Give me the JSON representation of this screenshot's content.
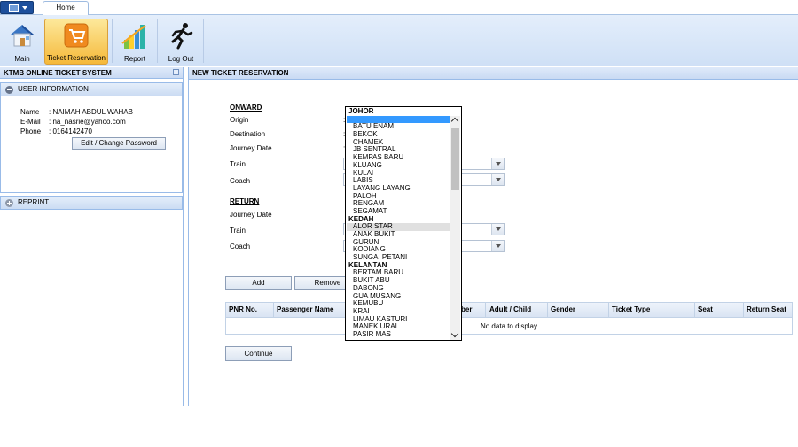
{
  "topbar": {
    "home_tab": "Home"
  },
  "ribbon": {
    "main": "Main",
    "ticket_reservation": "Ticket Reservation",
    "report": "Report",
    "logout": "Log Out"
  },
  "left": {
    "title": "KTMB ONLINE TICKET SYSTEM",
    "user_info": "USER INFORMATION",
    "name_label": "Name",
    "name_value": ": NAIMAH ABDUL WAHAB",
    "email_label": "E-Mail",
    "email_value": ": na_nasrie@yahoo.com",
    "phone_label": "Phone",
    "phone_value": ": 0164142470",
    "edit_button": "Edit / Change Password",
    "reprint": "REPRINT"
  },
  "main": {
    "title": "NEW TICKET RESERVATION",
    "onward": "ONWARD",
    "origin": "Origin",
    "destination": "Destination",
    "journey_date": "Journey Date",
    "train": "Train",
    "coach": "Coach",
    "return": "RETURN",
    "return_journey_date": "Journey Date",
    "return_train": "Train",
    "return_coach": "Coach",
    "add_button": "Add",
    "remove_button": "Remove",
    "continue_button": "Continue",
    "grid_headers": [
      "PNR No.",
      "Passenger Name",
      "ber",
      "Adult / Child",
      "Gender",
      "Ticket Type",
      "Seat",
      "Return Seat"
    ],
    "no_data": "No data to display"
  },
  "dropdown": {
    "items": [
      {
        "label": "JOHOR",
        "type": "group"
      },
      {
        "label": "",
        "type": "selected"
      },
      {
        "label": "BATU ENAM",
        "type": "item"
      },
      {
        "label": "BEKOK",
        "type": "item"
      },
      {
        "label": "CHAMEK",
        "type": "item"
      },
      {
        "label": "JB SENTRAL",
        "type": "item"
      },
      {
        "label": "KEMPAS BARU",
        "type": "item"
      },
      {
        "label": "KLUANG",
        "type": "item"
      },
      {
        "label": "KULAI",
        "type": "item"
      },
      {
        "label": "LABIS",
        "type": "item"
      },
      {
        "label": "LAYANG LAYANG",
        "type": "item"
      },
      {
        "label": "PALOH",
        "type": "item"
      },
      {
        "label": "RENGAM",
        "type": "item"
      },
      {
        "label": "SEGAMAT",
        "type": "item"
      },
      {
        "label": "KEDAH",
        "type": "group"
      },
      {
        "label": "ALOR STAR",
        "type": "hover"
      },
      {
        "label": "ANAK BUKIT",
        "type": "item"
      },
      {
        "label": "GURUN",
        "type": "item"
      },
      {
        "label": "KODIANG",
        "type": "item"
      },
      {
        "label": "SUNGAI PETANI",
        "type": "item"
      },
      {
        "label": "KELANTAN",
        "type": "group"
      },
      {
        "label": "BERTAM BARU",
        "type": "item"
      },
      {
        "label": "BUKIT ABU",
        "type": "item"
      },
      {
        "label": "DABONG",
        "type": "item"
      },
      {
        "label": "GUA MUSANG",
        "type": "item"
      },
      {
        "label": "KEMUBU",
        "type": "item"
      },
      {
        "label": "KRAI",
        "type": "item"
      },
      {
        "label": "LIMAU KASTURI",
        "type": "item"
      },
      {
        "label": "MANEK URAI",
        "type": "item"
      },
      {
        "label": "PASIR MAS",
        "type": "item"
      }
    ]
  }
}
